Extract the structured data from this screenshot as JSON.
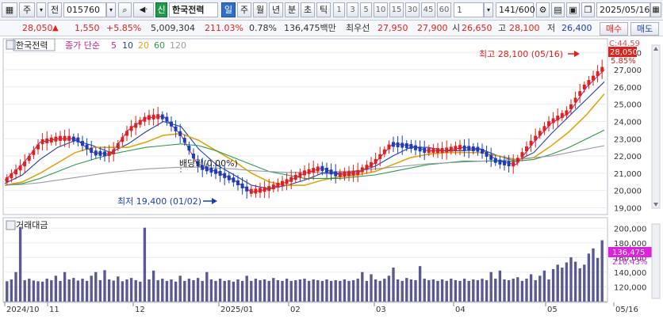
{
  "toolbar": {
    "market": "주",
    "prev_label": "전",
    "code": "015760",
    "badge": "신",
    "name": "한국전력",
    "periods": [
      "일",
      "주",
      "월",
      "년",
      "분",
      "초",
      "틱"
    ],
    "active_period": "일",
    "intervals": [
      "1",
      "3",
      "5",
      "10",
      "15",
      "30",
      "45",
      "60"
    ],
    "interval_input": "1",
    "count": "141",
    "count_max": "/600",
    "date": "2025/05/16"
  },
  "quote": {
    "price": "28,050",
    "change": "1,550",
    "change_pct": "+5.85%",
    "volume": "5,009,304",
    "volume_ratio": "211.03%",
    "turnover": "0.78%",
    "amount": "136,475백만",
    "best_ask_label": "최우선",
    "best_ask": "27,950",
    "best_bid": "27,900",
    "open_label": "시",
    "open": "26,650",
    "high_label": "고",
    "high": "28,100",
    "low_label": "저",
    "low": "26,400",
    "buy_label": "매수",
    "sell_label": "매도"
  },
  "colors": {
    "up": "#e0201b",
    "down": "#1a3fb8",
    "ma5": "#c02090",
    "ma10": "#1f3fb0",
    "ma20": "#e2a410",
    "ma60": "#2a9a4a",
    "ma120": "#9a9aa6",
    "volume_bar": "#5a5a90"
  },
  "chart_data": [
    {
      "type": "candlestick",
      "title": "한국전력",
      "legend": [
        {
          "label": "종가 단순",
          "key": "label"
        },
        {
          "label": "5",
          "key": "ma5"
        },
        {
          "label": "10",
          "key": "ma10"
        },
        {
          "label": "20",
          "key": "ma20"
        },
        {
          "label": "60",
          "key": "ma60"
        },
        {
          "label": "120",
          "key": "ma120"
        }
      ],
      "y_ticks": [
        "28,000",
        "27,000",
        "26,000",
        "25,000",
        "24,000",
        "23,000",
        "22,000",
        "21,000",
        "20,000",
        "19,000"
      ],
      "ylim": [
        18700,
        28700
      ],
      "price_tag": "28,050",
      "price_tag_pct": "5.85%",
      "high_label": "C:44.59",
      "annotations": {
        "high": "최고 28,100 (05/16)",
        "low": "최저 19,400 (01/02)",
        "dividend": "배당락(0.00%)"
      },
      "x_labels": [
        "2024/10",
        "11",
        "12",
        "2025/01",
        "02",
        "03",
        "04",
        "05",
        "05/16"
      ],
      "series": [
        {
          "name": "5",
          "values": [
            20600,
            21500,
            22800,
            23000,
            23000,
            22200,
            22100,
            23500,
            24200,
            24300,
            23200,
            21400,
            21100,
            20600,
            19900,
            20100,
            20500,
            21000,
            21300,
            20900,
            21000,
            21600,
            22700,
            22600,
            22300,
            22300,
            22500,
            22400,
            21700,
            21500,
            22800,
            23900,
            24500,
            26000,
            27000
          ]
        },
        {
          "name": "10",
          "values": [
            20400,
            20900,
            21800,
            22500,
            22900,
            22600,
            22200,
            22700,
            23400,
            24000,
            23700,
            22400,
            21500,
            20900,
            20300,
            20100,
            20300,
            20600,
            21000,
            21000,
            21100,
            21400,
            22000,
            22500,
            22500,
            22300,
            22300,
            22400,
            22000,
            21700,
            22200,
            23300,
            24300,
            25300,
            26300
          ]
        },
        {
          "name": "20",
          "values": [
            20300,
            20500,
            21000,
            21600,
            22200,
            22500,
            22500,
            22500,
            22800,
            23200,
            23300,
            22900,
            22300,
            21700,
            21000,
            20500,
            20300,
            20300,
            20600,
            20800,
            20900,
            21100,
            21500,
            21900,
            22100,
            22200,
            22200,
            22200,
            22000,
            21800,
            21900,
            22600,
            23400,
            24400,
            25600
          ]
        },
        {
          "name": "60",
          "values": [
            20300,
            20400,
            20700,
            21100,
            21500,
            21800,
            22100,
            22300,
            22500,
            22600,
            22700,
            22600,
            22300,
            21900,
            21500,
            21100,
            20900,
            20700,
            20700,
            20700,
            20800,
            20900,
            21100,
            21300,
            21500,
            21600,
            21700,
            21700,
            21700,
            21700,
            21800,
            22100,
            22500,
            23000,
            23500
          ]
        },
        {
          "name": "120",
          "values": [
            20300,
            20350,
            20450,
            20600,
            20750,
            20900,
            21050,
            21150,
            21250,
            21300,
            21350,
            21350,
            21300,
            21250,
            21150,
            21100,
            21050,
            21050,
            21050,
            21100,
            21150,
            21250,
            21350,
            21450,
            21550,
            21600,
            21650,
            21700,
            21750,
            21800,
            21900,
            22000,
            22200,
            22400,
            22600
          ]
        }
      ]
    },
    {
      "type": "bar",
      "title": "거래대금",
      "y_ticks": [
        "200,000",
        "180,000",
        "160,000",
        "140,000",
        "120,000"
      ],
      "ylim": [
        100000,
        210000
      ],
      "value_tag": "136,475",
      "value_tag_pct": "216.43%",
      "values": [
        55,
        60,
        80,
        202,
        58,
        62,
        57,
        55,
        54,
        62,
        58,
        70,
        56,
        80,
        60,
        64,
        57,
        62,
        56,
        70,
        80,
        58,
        85,
        60,
        57,
        68,
        55,
        60,
        64,
        58,
        54,
        200,
        60,
        84,
        58,
        62,
        56,
        60,
        54,
        70,
        56,
        62,
        58,
        64,
        56,
        80,
        60,
        56,
        62,
        56,
        58,
        54,
        60,
        56,
        70,
        56,
        62,
        58,
        60,
        56,
        64,
        58,
        56,
        62,
        56,
        58,
        60,
        62,
        56,
        60,
        58,
        56,
        60,
        56,
        58,
        56,
        60,
        56,
        58,
        62,
        80,
        56,
        74,
        60,
        56,
        62,
        70,
        92,
        60,
        56,
        64,
        60,
        58,
        96,
        62,
        58,
        60,
        56,
        60,
        56,
        62,
        58,
        56,
        62,
        56,
        60,
        58,
        62,
        58,
        80,
        62,
        84,
        60,
        58,
        62,
        66,
        56,
        62,
        74,
        58,
        70,
        84,
        60,
        88,
        100,
        92,
        106,
        120,
        108,
        90,
        100,
        130,
        144,
        118,
        166
      ]
    }
  ]
}
